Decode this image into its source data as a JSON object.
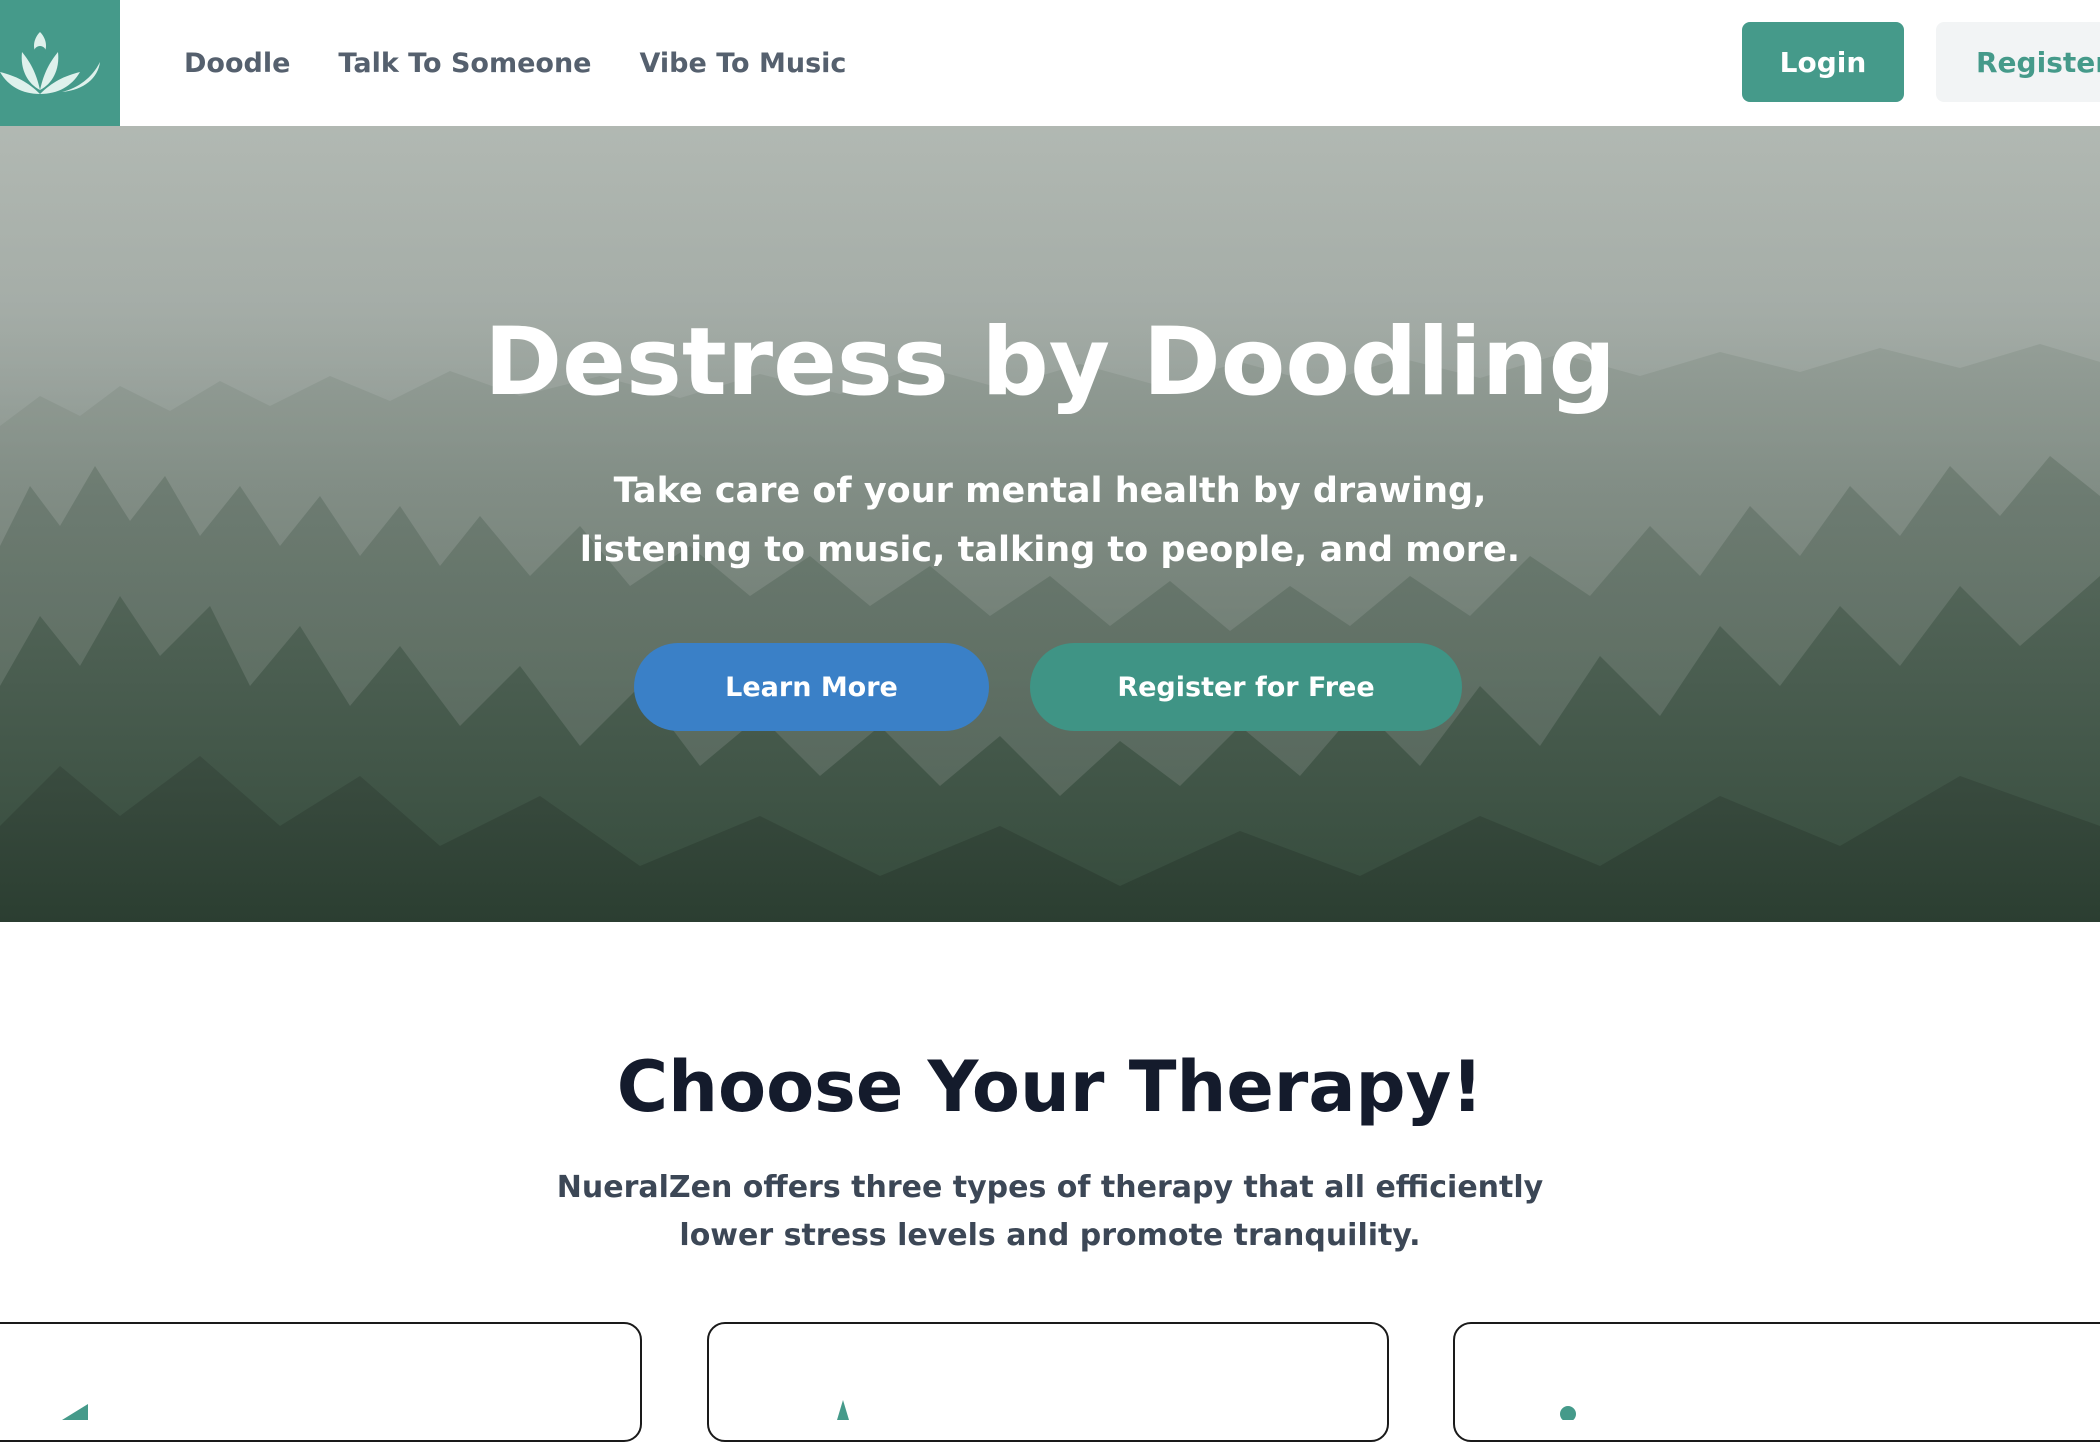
{
  "header": {
    "logo": {
      "icon": "lotus-icon",
      "color": "#459a8a"
    },
    "nav": [
      {
        "label": "Doodle"
      },
      {
        "label": "Talk To Someone"
      },
      {
        "label": "Vibe To Music"
      }
    ],
    "login_label": "Login",
    "register_label": "Register"
  },
  "hero": {
    "title": "Destress by Doodling",
    "subtitle": "Take care of your mental health by drawing, listening to music, talking to people, and more.",
    "learn_more_label": "Learn More",
    "register_free_label": "Register for Free",
    "background": "misty-forest-image"
  },
  "therapy": {
    "title": "Choose Your Therapy!",
    "subtitle": "NueralZen offers three types of therapy that all efficiently lower stress levels and promote tranquility.",
    "cards_visible": 3
  },
  "colors": {
    "teal": "#459a8a",
    "blue": "#3a80c7",
    "nav_text": "#55606e",
    "heading": "#141b2c"
  }
}
